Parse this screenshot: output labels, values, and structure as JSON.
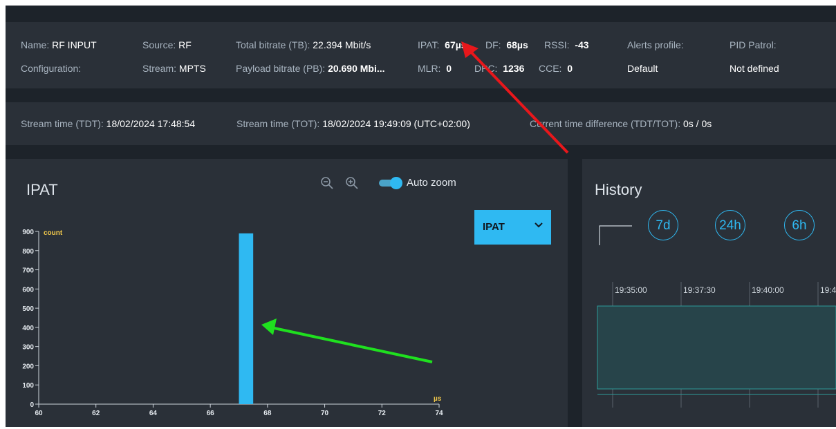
{
  "stream_info": {
    "name_label": "Name:",
    "name_value": "RF INPUT",
    "config_label": "Configuration:",
    "source_label": "Source:",
    "source_value": "RF",
    "stream_label": "Stream:",
    "stream_value": "MPTS",
    "tb_label": "Total bitrate (TB):",
    "tb_value": "22.394 Mbit/s",
    "pb_label": "Payload bitrate (PB):",
    "pb_value": "20.690 Mbi...",
    "ipat_label": "IPAT:",
    "ipat_value": "67µs",
    "df_label": "DF:",
    "df_value": "68µs",
    "rssi_label": "RSSI:",
    "rssi_value": "-43",
    "mlr_label": "MLR:",
    "mlr_value": "0",
    "dpc_label": "DPC:",
    "dpc_value": "1236",
    "cce_label": "CCE:",
    "cce_value": "0",
    "alerts_label": "Alerts profile:",
    "alerts_value": "Default",
    "pid_label": "PID Patrol:",
    "pid_value": "Not defined"
  },
  "time_info": {
    "tdt_label": "Stream time (TDT):",
    "tdt_value": "18/02/2024 17:48:54",
    "tot_label": "Stream time (TOT):",
    "tot_value": "18/02/2024 19:49:09 (UTC+02:00)",
    "diff_label": "Current time difference (TDT/TOT):",
    "diff_value": "0s / 0s"
  },
  "ipat_panel": {
    "title": "IPAT",
    "auto_zoom_label": "Auto zoom",
    "auto_zoom_on": true,
    "select_value": "IPAT",
    "icons": [
      "zoom-out-icon",
      "zoom-in-icon",
      "chevron-down-icon"
    ]
  },
  "history_panel": {
    "title": "History",
    "ranges": [
      "7d",
      "24h",
      "6h"
    ],
    "timeline_labels": [
      "19:35:00",
      "19:37:30",
      "19:40:00",
      "19:4"
    ]
  },
  "chart_data": {
    "type": "bar",
    "ylabel": "count",
    "xlabel": "µs",
    "xlim": [
      60,
      74
    ],
    "ylim": [
      0,
      900
    ],
    "xticks": [
      "60",
      "62",
      "64",
      "66",
      "68",
      "70",
      "72",
      "74"
    ],
    "yticks": [
      "0",
      "100",
      "200",
      "300",
      "400",
      "500",
      "600",
      "700",
      "800",
      "900"
    ],
    "bars": [
      {
        "x_start": 67,
        "x_end": 67.5,
        "value": 890
      }
    ]
  },
  "colors": {
    "accent": "#2fb9f2",
    "axis_label": "#f2c94c",
    "annotation_red": "#e8171b",
    "annotation_green": "#1fe01f"
  }
}
